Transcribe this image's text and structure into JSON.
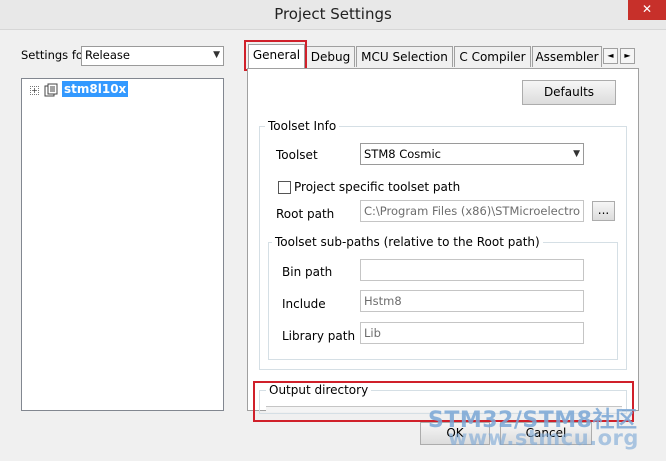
{
  "window": {
    "title": "Project Settings",
    "close_glyph": "✕"
  },
  "settings_for": {
    "label": "Settings for:",
    "value": "Release"
  },
  "tree": {
    "expander": "+",
    "node_label": "stm8l10x"
  },
  "tabs": [
    "General",
    "Debug",
    "MCU Selection",
    "C Compiler",
    "Assembler"
  ],
  "tab_scroll": {
    "left": "◄",
    "right": "►"
  },
  "general": {
    "defaults_label": "Defaults",
    "toolset_info": {
      "title": "Toolset Info",
      "toolset_label": "Toolset",
      "toolset_value": "STM8 Cosmic",
      "project_specific_label": "Project specific toolset path",
      "root_path_label": "Root path",
      "root_path_value": "C:\\Program Files (x86)\\STMicroelectro",
      "browse_label": "..."
    },
    "subpaths": {
      "title": "Toolset sub-paths (relative to the Root path)",
      "bin_label": "Bin path",
      "bin_value": "",
      "include_label": "Include",
      "include_value": "Hstm8",
      "library_label": "Library path",
      "library_value": "Lib"
    },
    "output_directory_label": "Output directory"
  },
  "buttons": {
    "ok": "OK",
    "cancel": "Cancel"
  },
  "watermark": {
    "line1_a": "STM32/STM8",
    "line1_b": "社区",
    "line2": "www.stmcu.org"
  },
  "colors": {
    "highlight": "#d0202a",
    "selection": "#3399ff",
    "watermark": "#7aa7d6"
  }
}
